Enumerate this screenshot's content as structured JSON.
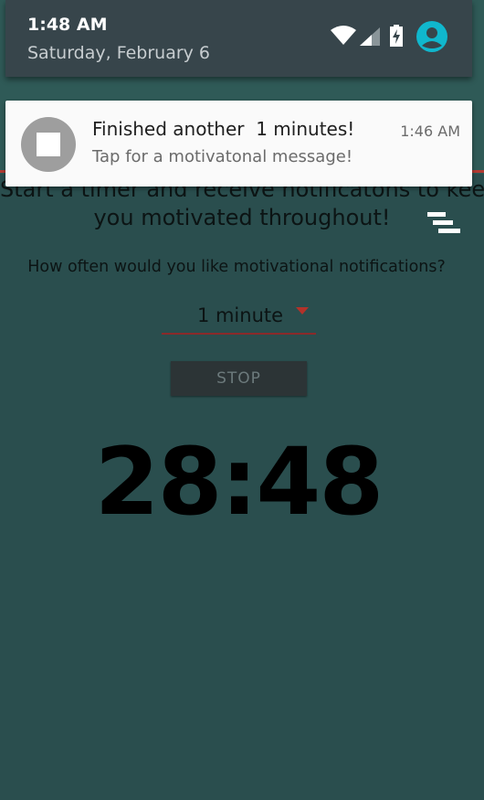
{
  "status_bar": {
    "time": "1:48 AM",
    "date": "Saturday, February 6",
    "icons": [
      "wifi-icon",
      "signal-icon",
      "battery-charging-icon",
      "account-icon"
    ],
    "accent": "#10b7cd"
  },
  "notification": {
    "icon": "stop-icon",
    "title": "Finished another  1 minutes!",
    "text": "Tap for a motivatonal message!",
    "time": "1:46 AM"
  },
  "app": {
    "intro_line1": "Start a timer and receive notificatons to keep",
    "intro_line2": "you motivated throughout!",
    "menu_icon": "hamburger-icon",
    "question": "How often would you like motivational notifications?",
    "interval": {
      "selected": "1 minute"
    },
    "stop_label": "STOP",
    "timer_value": "28:48",
    "colors": {
      "background": "#2a4e4e",
      "accent": "#b3322a"
    }
  }
}
